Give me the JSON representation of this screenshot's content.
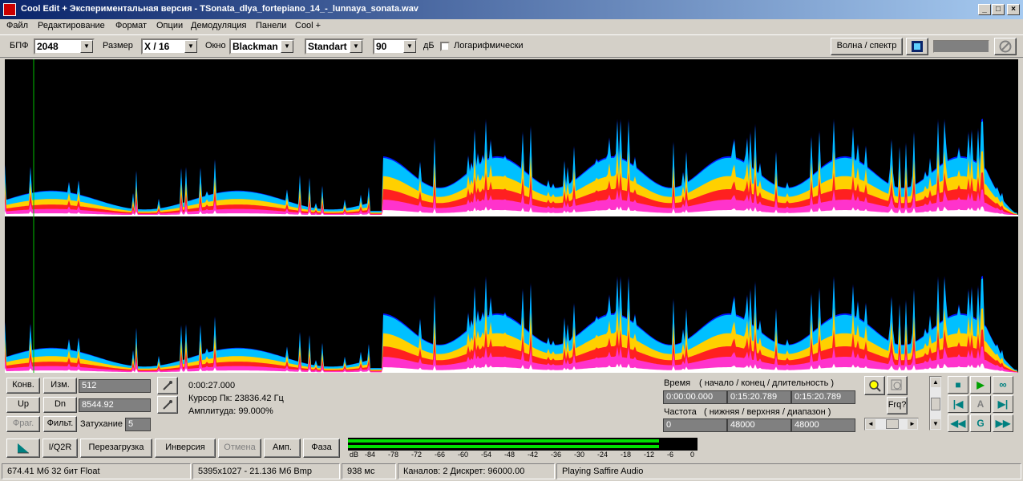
{
  "window": {
    "title": "Cool Edit + Экспериментальная версия - TSonata_dlya_fortepiano_14_-_lunnaya_sonata.wav"
  },
  "menu": [
    "Файл",
    "Редактирование",
    "Формат",
    "Опции",
    "Демодуляция",
    "Панели",
    "Cool +"
  ],
  "toolbar": {
    "fft_label": "БПФ",
    "fft_value": "2048",
    "size_label": "Размер",
    "size_value": "X / 16",
    "window_label": "Окно",
    "window_value": "Blackman",
    "mode_value": "Standart",
    "db_value": "90",
    "db_unit": "дБ",
    "log_label": "Логарифмически",
    "wave_spectrum_label": "Волна / спектр"
  },
  "controls": {
    "konv": "Конв.",
    "izm": "Изм.",
    "up": "Up",
    "dn": "Dn",
    "frag": "Фраг.",
    "filt": "Фильт.",
    "value1": "512",
    "value2": "8544.92",
    "decay_label": "Затухание",
    "decay_value": "5"
  },
  "info": {
    "time": "0:00:27.000",
    "cursor": "Курсор Пк: 23836.42 Гц",
    "amplitude": "Амплитуда: 99.000%"
  },
  "time_panel": {
    "label": "Время",
    "hint": "( начало / конец / длительность )",
    "start": "0:00:00.000",
    "end": "0:15:20.789",
    "duration": "0:15:20.789"
  },
  "freq_panel": {
    "label": "Частота",
    "hint": "( нижняя / верхняя / диапазон )",
    "low": "0",
    "high": "48000",
    "range": "48000"
  },
  "zoom": {
    "frq_label": "Frq?"
  },
  "transport": {
    "a_label": "A",
    "g_label": "G"
  },
  "bottom_buttons": {
    "iq2r": "I/Q2R",
    "reload": "Перезагрузка",
    "inversion": "Инверсия",
    "cancel": "Отмена",
    "amp": "Амп.",
    "phase": "Фаза"
  },
  "meter": {
    "ticks": [
      "dB",
      "-84",
      "-78",
      "-72",
      "-66",
      "-60",
      "-54",
      "-48",
      "-42",
      "-36",
      "-30",
      "-24",
      "-18",
      "-12",
      "-6",
      "0"
    ],
    "level_fraction": 0.89
  },
  "status": {
    "memory": "674.41 Мб 32 бит Float",
    "bitmap": "5395x1027 - 21.136 Мб Bmp",
    "latency": "938 мс",
    "channels": "Каналов: 2  Дискрет: 96000.00",
    "playing": "Playing Saffire Audio"
  },
  "colors": {
    "title_start": "#0a246a",
    "title_end": "#a6caf0",
    "background": "#d4d0c8",
    "spectrogram_bg": "#000000",
    "cursor_line": "#00c000",
    "meter_green": "#00e000",
    "transport_teal": "#008080"
  }
}
